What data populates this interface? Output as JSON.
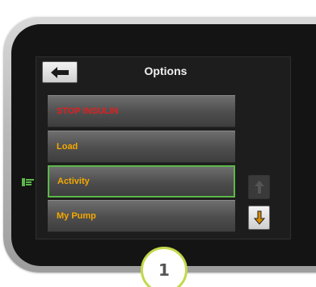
{
  "screen": {
    "title": "Options"
  },
  "menu": {
    "items": [
      {
        "label": "STOP INSULIN",
        "color": "#e02020"
      },
      {
        "label": "Load",
        "color": "#f6a800"
      },
      {
        "label": "Activity",
        "color": "#f6a800",
        "selected": true
      },
      {
        "label": "My Pump",
        "color": "#f6a800"
      }
    ]
  },
  "icons": {
    "back": "left-arrow-icon",
    "scroll_up": "up-arrow-icon",
    "scroll_down": "down-arrow-icon",
    "pointer": "pointing-hand-icon"
  },
  "callout": {
    "number": "1"
  },
  "colors": {
    "accent_label": "#f6a800",
    "alert_label": "#e02020",
    "selection_border": "#5db84a",
    "callout_ring": "#c4d84a"
  }
}
